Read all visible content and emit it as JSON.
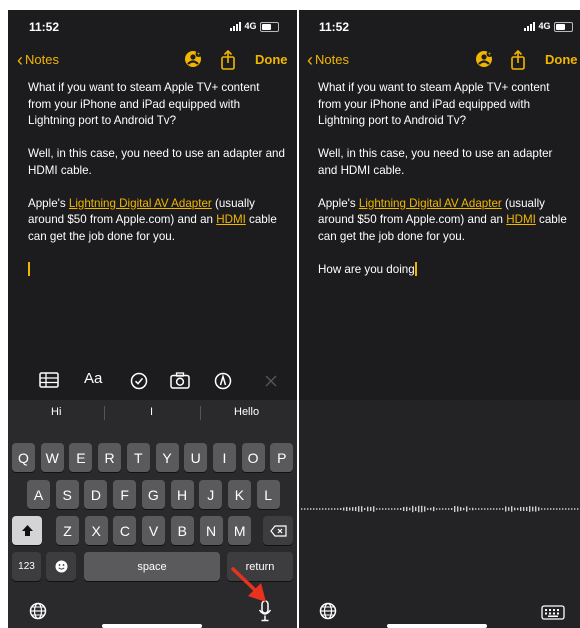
{
  "status": {
    "time": "11:52",
    "network": "4G"
  },
  "nav": {
    "back_label": "Notes",
    "done_label": "Done"
  },
  "note": {
    "p1": "What if you want to steam Apple TV+ content from your iPhone and iPad equipped with Lightning port to Android Tv?",
    "p2": "Well, in this case, you need to use an adapter and HDMI cable.",
    "p3_pre": "Apple's ",
    "p3_link1": "Lightning Digital AV Adapter",
    "p3_mid": " (usually around $50 from Apple.com) and an ",
    "p3_link2": "HDMI",
    "p3_post": " cable can get the job done for you.",
    "dictated": "How are you doing"
  },
  "toolbar": {
    "icons": [
      "table-icon",
      "text-format-icon",
      "checklist-icon",
      "camera-icon",
      "markup-icon",
      "close-icon"
    ],
    "format_label": "Aa"
  },
  "suggestions": [
    "Hi",
    "I",
    "Hello"
  ],
  "keyboard": {
    "row1": [
      "Q",
      "W",
      "E",
      "R",
      "T",
      "Y",
      "U",
      "I",
      "O",
      "P"
    ],
    "row2": [
      "A",
      "S",
      "D",
      "F",
      "G",
      "H",
      "J",
      "K",
      "L"
    ],
    "row3": [
      "Z",
      "X",
      "C",
      "V",
      "B",
      "N",
      "M"
    ],
    "numbers_label": "123",
    "space_label": "space",
    "return_label": "return"
  },
  "colors": {
    "accent": "#f2b600",
    "background": "#1c1c1e",
    "keyboard": "#2a2a2c",
    "arrow": "#e8321e"
  }
}
